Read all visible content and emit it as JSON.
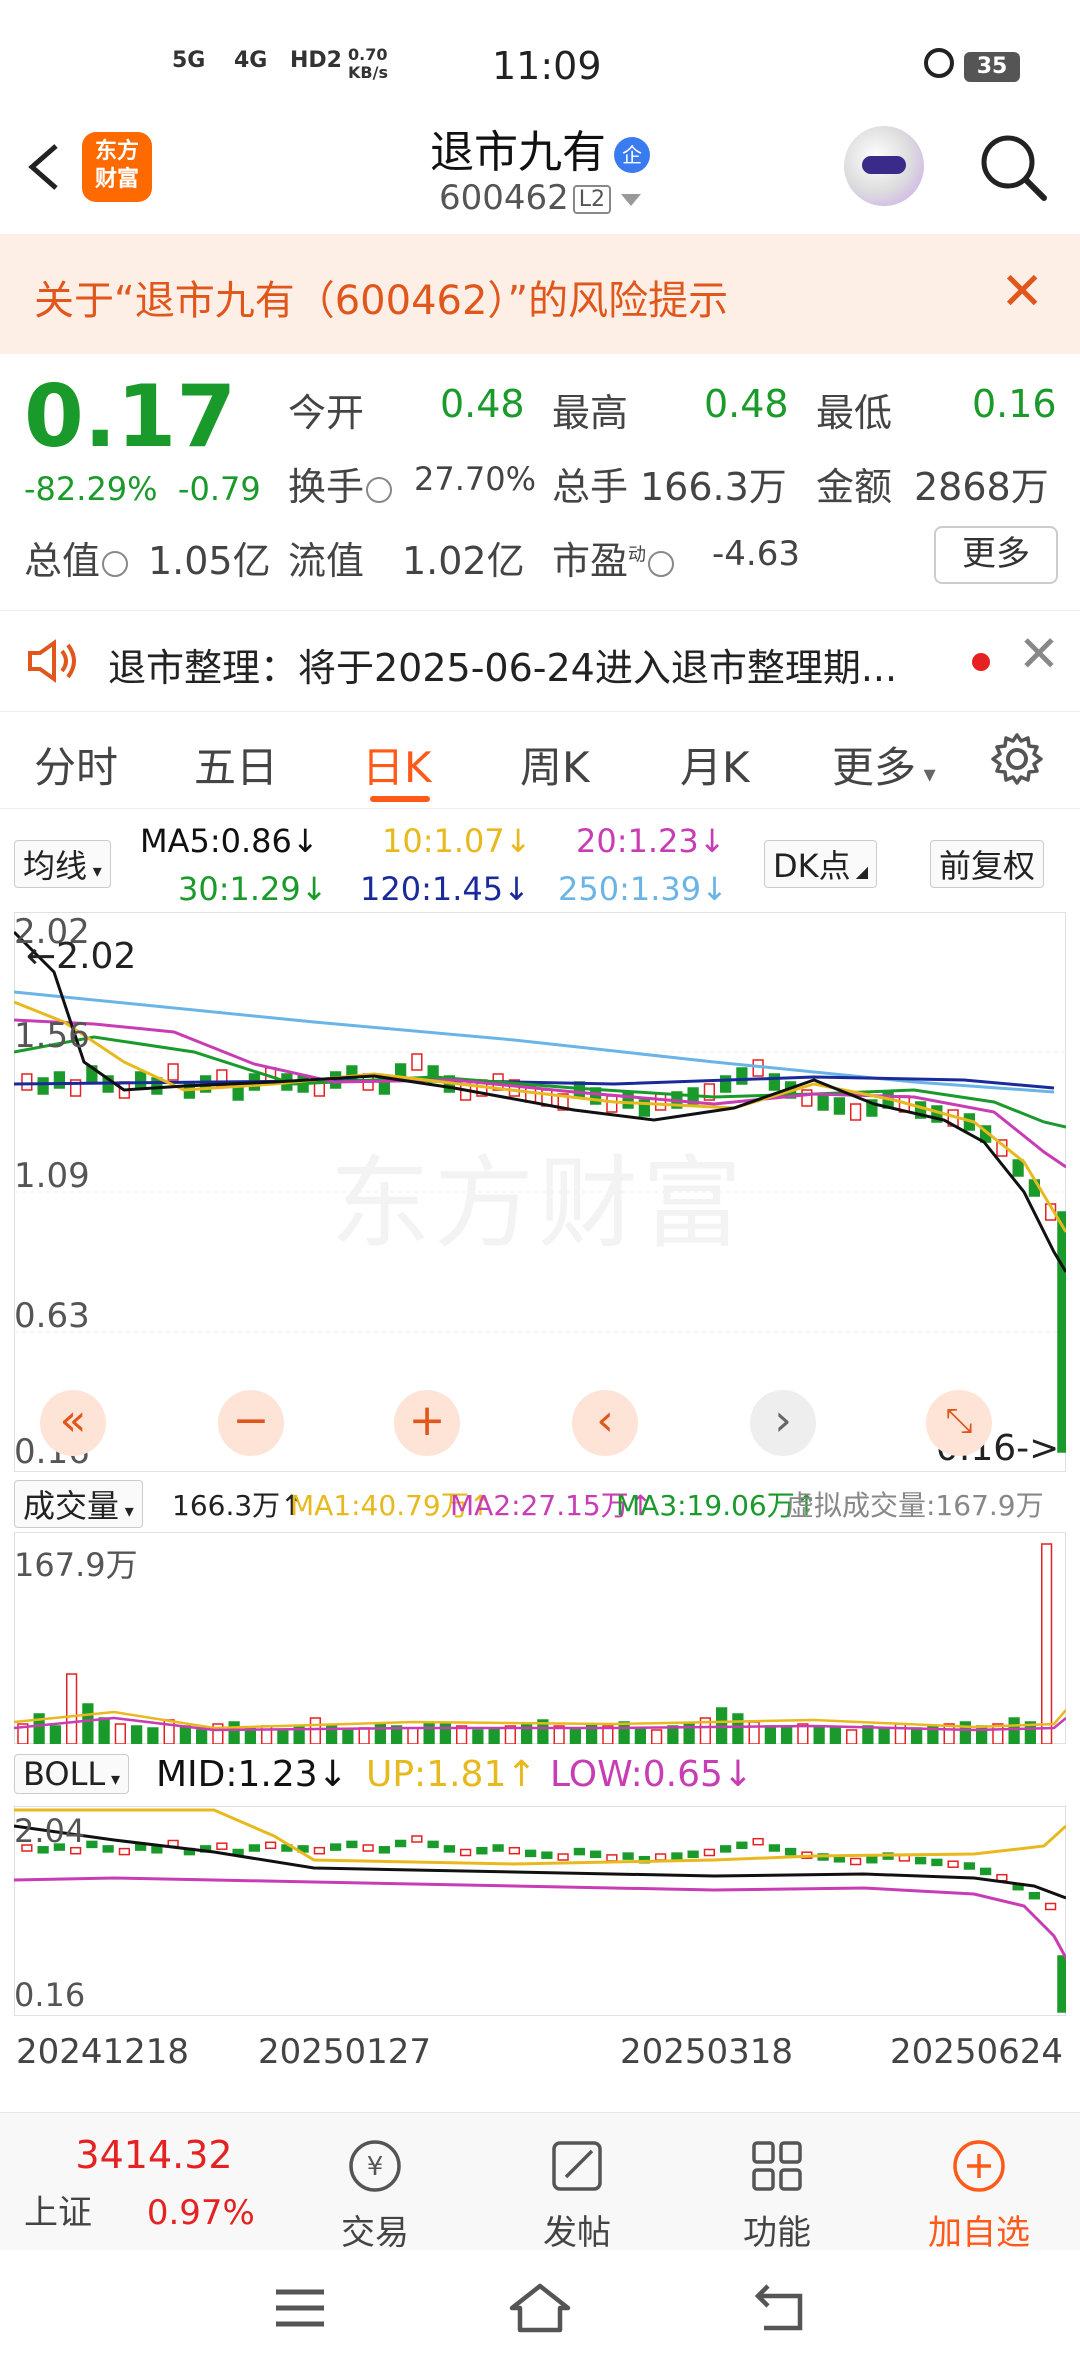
{
  "status_bar": {
    "signal1": "5G",
    "signal2": "4G",
    "hd": "HD2",
    "net_speed": "0.70 KB/s",
    "time": "11:09",
    "battery": "35"
  },
  "header": {
    "logo": "东方财富",
    "title": "退市九有",
    "qi_badge": "企",
    "code": "600462",
    "level": "L2"
  },
  "warning": {
    "text": "关于“退市九有（600462）”的风险提示"
  },
  "quote": {
    "price": "0.17",
    "change_pct": "-82.29%",
    "change_amt": "-0.79",
    "open_label": "今开",
    "open": "0.48",
    "high_label": "最高",
    "high": "0.48",
    "low_label": "最低",
    "low": "0.16",
    "turnover_label": "换手",
    "turnover": "27.70%",
    "volume_label": "总手",
    "volume": "166.3万",
    "amount_label": "金额",
    "amount": "2868万",
    "mcap_label": "总值",
    "mcap": "1.05亿",
    "float_label": "流值",
    "float": "1.02亿",
    "pe_label": "市盈",
    "pe_sup": "动",
    "pe": "-4.63",
    "more": "更多"
  },
  "notice": {
    "text": "退市整理：将于2025-06-24进入退市整理期..."
  },
  "tabs": [
    "分时",
    "五日",
    "日K",
    "周K",
    "月K",
    "更多"
  ],
  "active_tab": "日K",
  "ma": {
    "selector": "均线",
    "ma5": "MA5:0.86↓",
    "ma10": "10:1.07↓",
    "ma20": "20:1.23↓",
    "ma30": "30:1.29↓",
    "ma120": "120:1.45↓",
    "ma250": "250:1.39↓",
    "dk": "DK点",
    "adjust": "前复权"
  },
  "kline": {
    "ylabels": [
      "2.02",
      "1.56",
      "1.09",
      "0.63",
      "0.16"
    ],
    "high_mark": "←2.02",
    "low_mark": "0.16->",
    "watermark": "东方财富"
  },
  "volume": {
    "selector": "成交量",
    "value": "166.3万↑",
    "ma1": "MA1:40.79万↑",
    "ma2": "MA2:27.15万↑",
    "ma3": "MA3:19.06万↑",
    "virtual": "虚拟成交量:167.9万",
    "max_label": "167.9万"
  },
  "boll": {
    "selector": "BOLL",
    "mid": "MID:1.23↓",
    "up": "UP:1.81↑",
    "low": "LOW:0.65↓",
    "ylabels": [
      "2.04",
      "0.16"
    ]
  },
  "dates": [
    "20241218",
    "20250127",
    "20250318",
    "20250624"
  ],
  "bottom_nav": {
    "index_value": "3414.32",
    "index_name": "上证",
    "index_pct": "0.97%",
    "items": [
      "交易",
      "发帖",
      "功能",
      "加自选"
    ]
  },
  "colors": {
    "up_red": "#e52121",
    "down_green": "#1a9a2a",
    "accent": "#ff5a1a",
    "ma5": "#111111",
    "ma10": "#e8b91e",
    "ma20": "#c83cb4",
    "ma30": "#1a9a2a",
    "ma120": "#1a2a9a",
    "ma250": "#6ab4e6"
  }
}
